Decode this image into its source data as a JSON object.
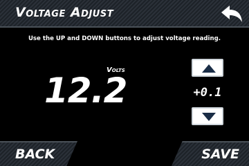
{
  "header": {
    "title": "Voltage Adjust",
    "back_icon": "back-arrow-icon"
  },
  "instruction": "Use the UP and DOWN buttons to adjust voltage reading.",
  "voltage": {
    "unit_label": "Volts",
    "value": "12.2"
  },
  "stepper": {
    "step_value": "+0.1",
    "up_icon": "triangle-up-icon",
    "down_icon": "triangle-down-icon"
  },
  "footer": {
    "back_label": "BACK",
    "save_label": "SAVE"
  },
  "colors": {
    "background": "#000000",
    "text": "#ffffff",
    "header_bar": "#2b3139",
    "button_face": "#ffffff",
    "arrow": "#1a2d46"
  }
}
